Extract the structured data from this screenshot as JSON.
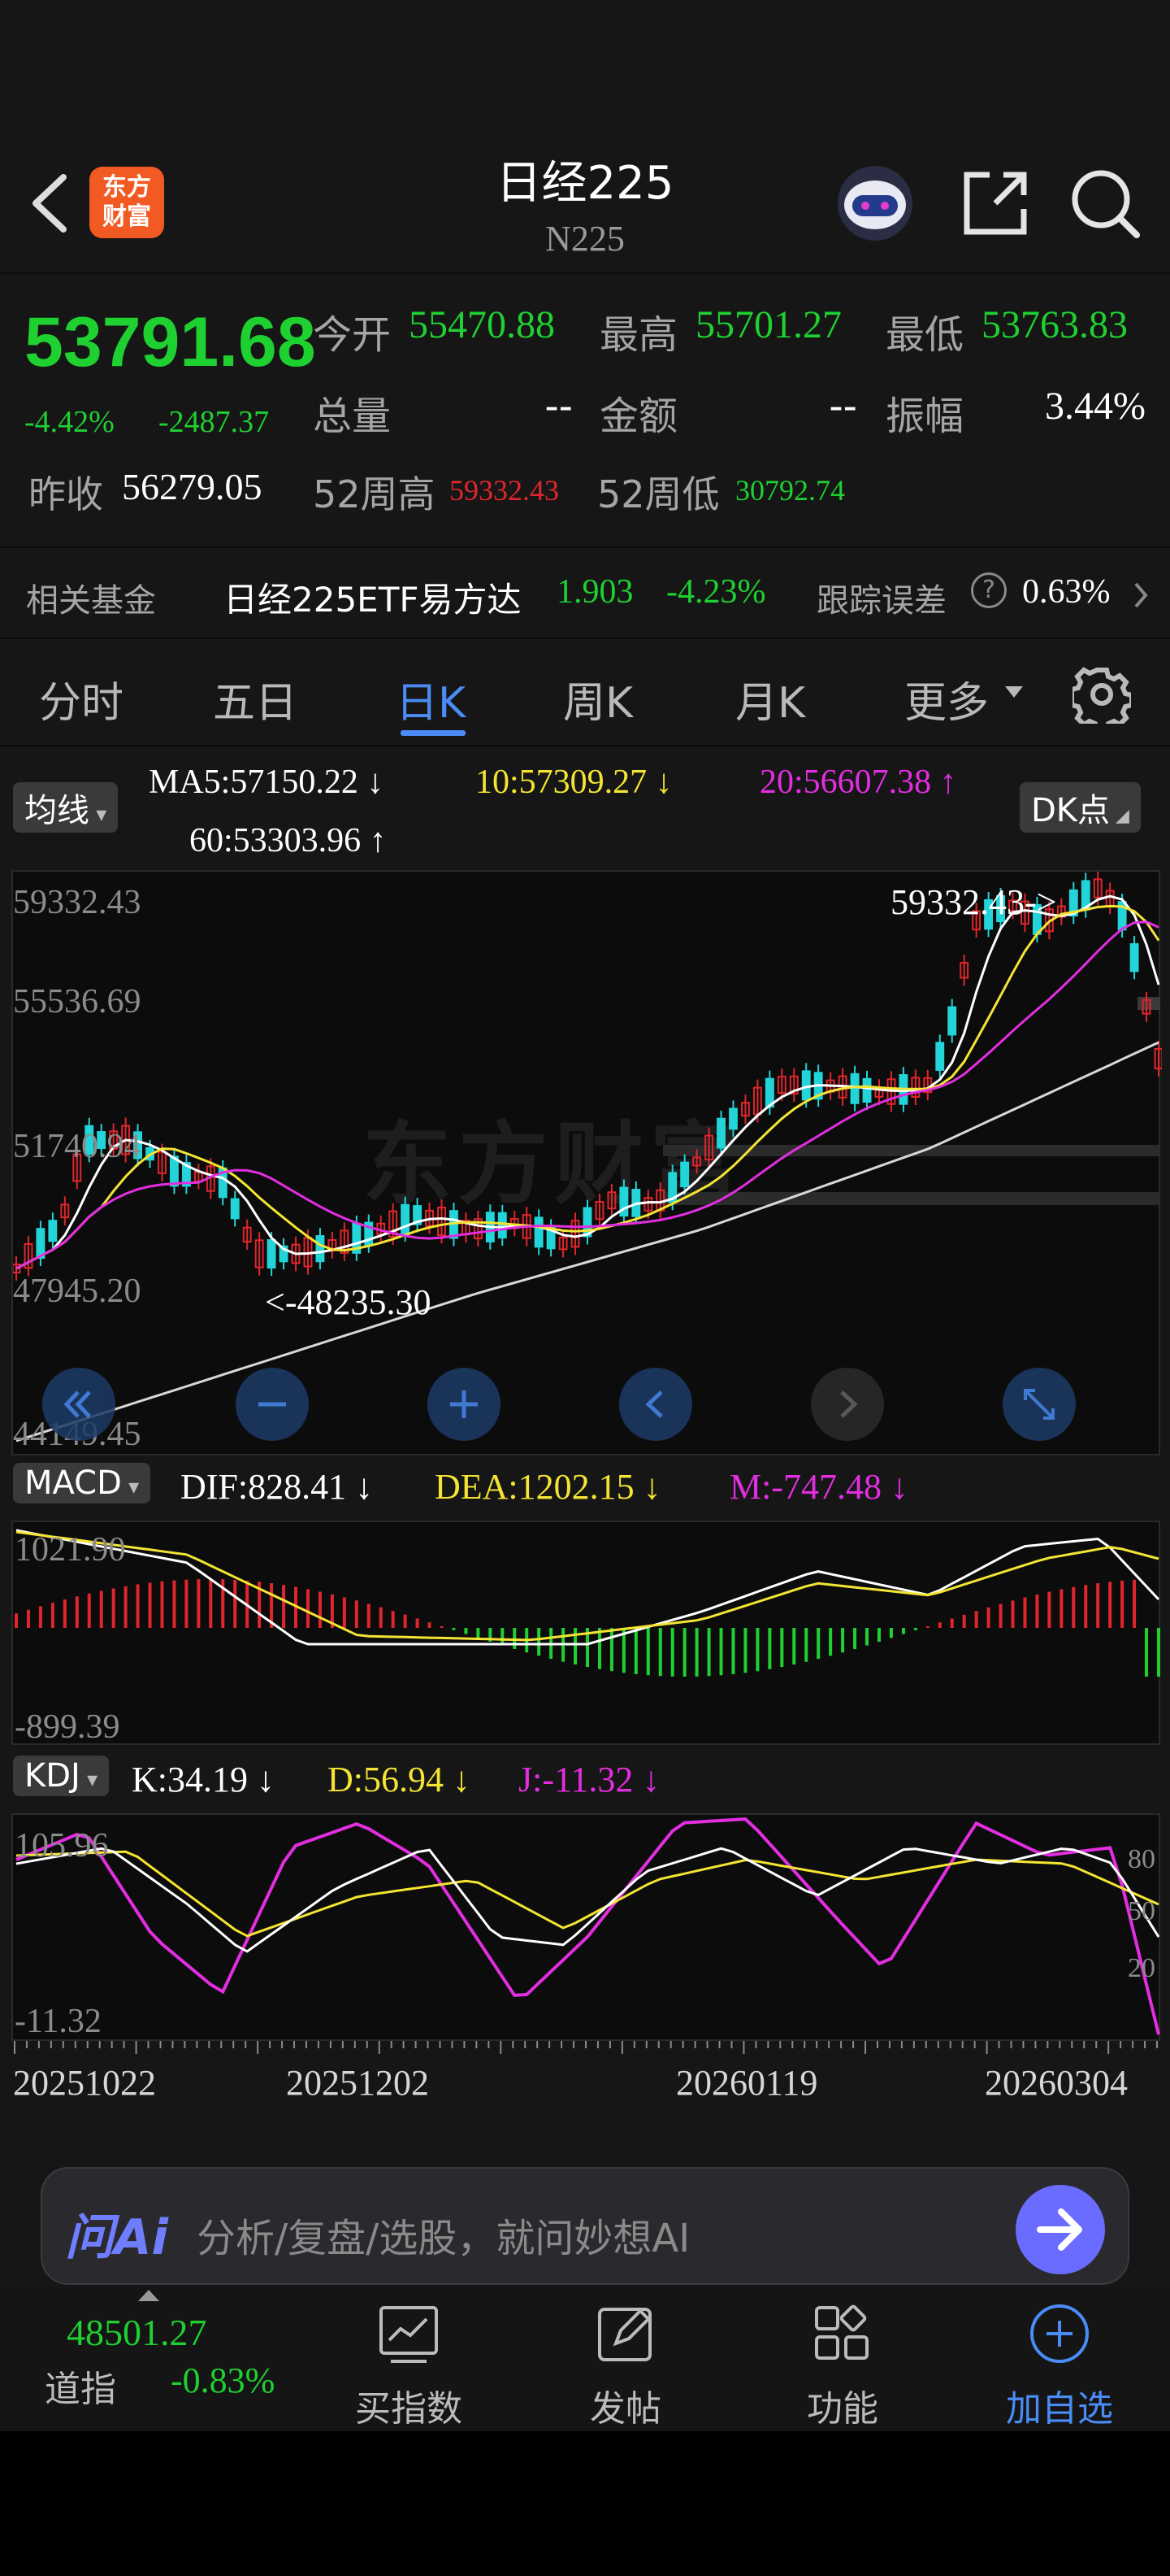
{
  "header": {
    "title": "日经225",
    "code": "N225",
    "logo_text_top": "东方",
    "logo_text_bottom": "财富"
  },
  "quote": {
    "price": "53791.68",
    "change_pct": "-4.42%",
    "change_abs": "-2487.37",
    "open_label": "今开",
    "open": "55470.88",
    "high_label": "最高",
    "high": "55701.27",
    "low_label": "最低",
    "low": "53763.83",
    "volume_label": "总量",
    "volume": "--",
    "amount_label": "金额",
    "amount": "--",
    "amplitude_label": "振幅",
    "amplitude": "3.44%",
    "prev_close_label": "昨收",
    "prev_close": "56279.05",
    "w52_high_label": "52周高",
    "w52_high": "59332.43",
    "w52_low_label": "52周低",
    "w52_low": "30792.74"
  },
  "fund": {
    "label": "相关基金",
    "name": "日经225ETF易方达",
    "price": "1.903",
    "change": "-4.23%",
    "tracking_label": "跟踪误差",
    "tracking_value": "0.63%"
  },
  "tabs": [
    "分时",
    "五日",
    "日K",
    "周K",
    "月K",
    "更多"
  ],
  "active_tab": "日K",
  "ma": {
    "selector": "均线",
    "ma5": "MA5:57150.22",
    "ma10": "10:57309.27",
    "ma20": "20:56607.38",
    "ma60": "60:53303.96",
    "dk_label": "DK点",
    "arrow_down": "↓",
    "arrow_up": "↑"
  },
  "kline": {
    "y_labels": [
      "59332.43",
      "55536.69",
      "51740.94",
      "47945.20",
      "44149.45"
    ],
    "max_annotation": "59332.43->",
    "min_annotation": "<-48235.30",
    "watermark": "东方财富"
  },
  "macd": {
    "selector": "MACD",
    "dif": "DIF:828.41",
    "dea": "DEA:1202.15",
    "m": "M:-747.48",
    "y_top": "1021.90",
    "y_bottom": "-899.39"
  },
  "kdj": {
    "selector": "KDJ",
    "k": "K:34.19",
    "d": "D:56.94",
    "j": "J:-11.32",
    "y_top": "105.96",
    "y_bottom": "-11.32",
    "right_labels": [
      "80",
      "50",
      "20"
    ]
  },
  "dates": [
    "20251022",
    "20251202",
    "20260119",
    "20260304"
  ],
  "ai_bar": {
    "brand": "问Ai",
    "placeholder": "分析/复盘/选股，就问妙想AI"
  },
  "bottom_nav": {
    "index_value": "48501.27",
    "index_name": "道指",
    "index_change": "-0.83%",
    "items": [
      "买指数",
      "发帖",
      "功能",
      "加自选"
    ]
  },
  "colors": {
    "up": "#e0262c",
    "down": "#1fd031",
    "ma5": "#ffffff",
    "ma10": "#f4e433",
    "ma20": "#e22ee0",
    "ma60": "#d8d8d8",
    "candle_down": "#23d4d9",
    "accent": "#4a8cf5"
  }
}
